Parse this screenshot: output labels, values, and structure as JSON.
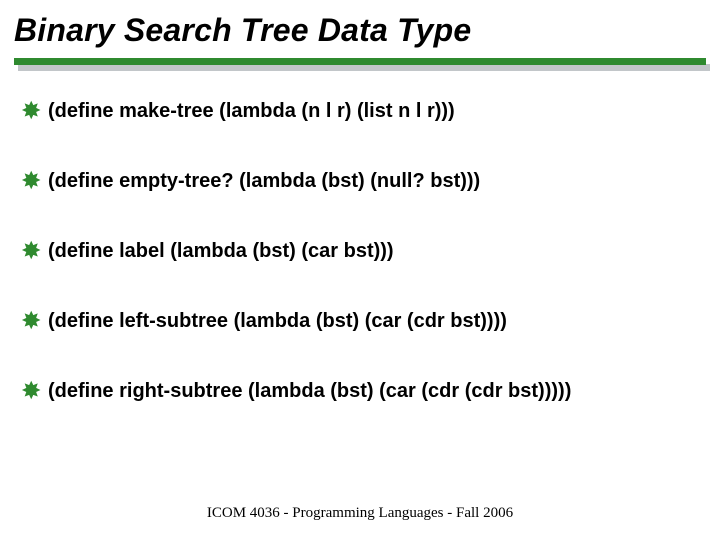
{
  "slide": {
    "title": "Binary Search Tree Data Type",
    "items": [
      "(define make-tree (lambda (n l r) (list n l r)))",
      "(define empty-tree? (lambda (bst) (null? bst)))",
      "(define label (lambda (bst) (car bst)))",
      "(define left-subtree (lambda (bst) (car (cdr bst))))",
      "(define right-subtree (lambda (bst) (car (cdr (cdr bst)))))"
    ],
    "footer": "ICOM 4036 - Programming Languages - Fall 2006"
  }
}
